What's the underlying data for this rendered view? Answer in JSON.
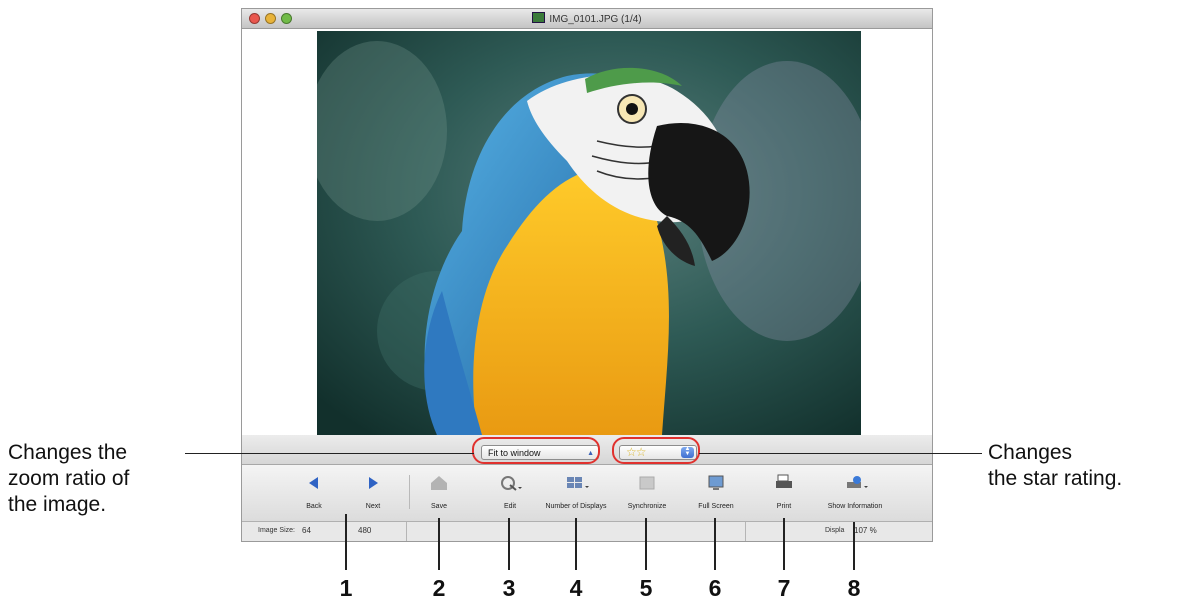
{
  "window": {
    "title": "IMG_0101.JPG (1/4)"
  },
  "zoom": {
    "value": "Fit to window"
  },
  "rating": {
    "stars": "☆☆"
  },
  "toolbar": {
    "back": "Back",
    "next": "Next",
    "save": "Save",
    "edit": "Edit",
    "displays": "Number of Displays",
    "synchronize": "Synchronize",
    "fullscreen": "Full Screen",
    "print": "Print",
    "info": "Show Information"
  },
  "status": {
    "image_size_label": "Image Size:",
    "width": "64",
    "height": "480",
    "display_label": "Displa",
    "display_value": "107 %"
  },
  "callouts": {
    "left": [
      "Changes the",
      "zoom ratio of",
      "the image."
    ],
    "right": [
      "Changes",
      "the star rating."
    ]
  },
  "numbers": [
    "1",
    "2",
    "3",
    "4",
    "5",
    "6",
    "7",
    "8"
  ],
  "colors": {
    "callout": "#e0312e",
    "star": "#d9b52b"
  }
}
